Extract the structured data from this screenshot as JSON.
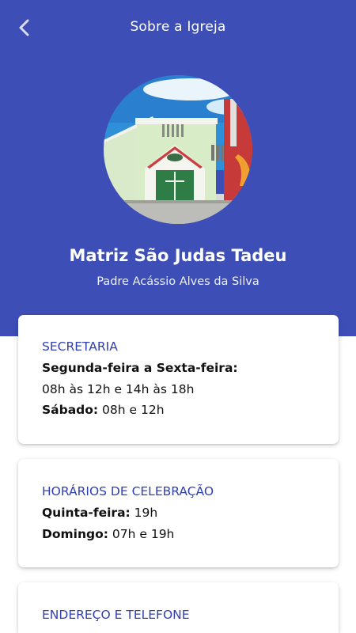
{
  "header": {
    "title": "Sobre a Igreja"
  },
  "profile": {
    "church_name": "Matriz São Judas Tadeu",
    "priest": "Padre Acássio Alves da Silva"
  },
  "cards": {
    "secretaria": {
      "title": "SECRETARIA",
      "weekdays_label": "Segunda-feira a Sexta-feira:",
      "weekdays_hours": "08h às 12h e 14h às 18h",
      "saturday_label": "Sábado:",
      "saturday_hours": " 08h e 12h"
    },
    "celebracao": {
      "title": "HORÁRIOS DE CELEBRAÇÃO",
      "thursday_label": "Quinta-feira:",
      "thursday_hours": " 19h",
      "sunday_label": "Domingo:",
      "sunday_hours": " 07h e 19h"
    },
    "endereco": {
      "title": "ENDEREÇO E TELEFONE"
    }
  },
  "colors": {
    "brand_blue": "#3d4fb6",
    "title_blue": "#2f3fb0"
  },
  "icons": {
    "back": "chevron-left-icon"
  }
}
